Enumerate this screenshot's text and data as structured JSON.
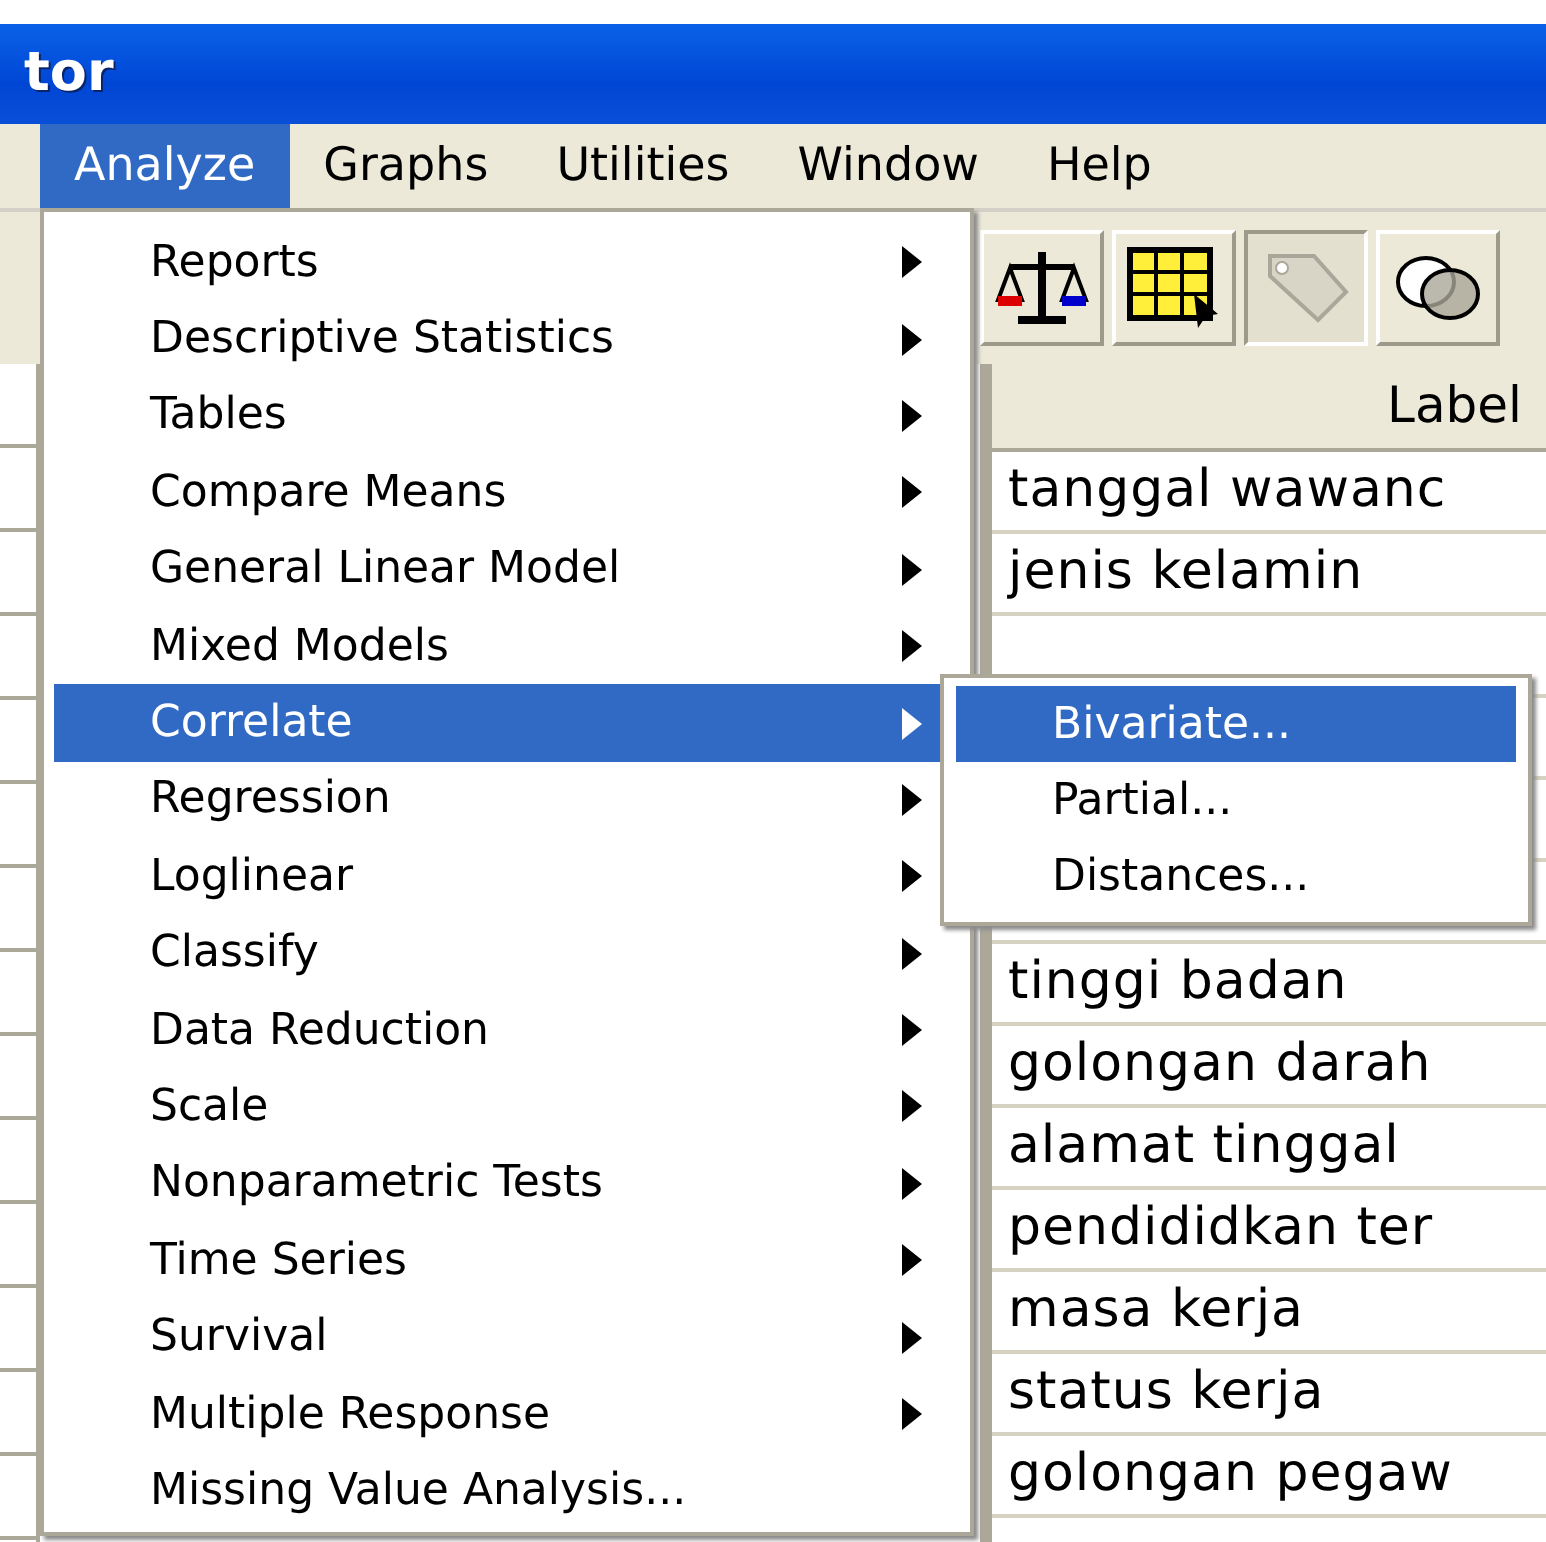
{
  "window": {
    "title": "tor"
  },
  "menu_bar": [
    {
      "label": "Analyze",
      "selected": true
    },
    {
      "label": "Graphs",
      "selected": false
    },
    {
      "label": "Utilities",
      "selected": false
    },
    {
      "label": "Window",
      "selected": false
    },
    {
      "label": "Help",
      "selected": false
    }
  ],
  "analyze_menu": [
    {
      "label": "Reports",
      "kind": "submenu",
      "selected": false
    },
    {
      "label": "Descriptive Statistics",
      "kind": "submenu",
      "selected": false
    },
    {
      "label": "Tables",
      "kind": "submenu",
      "selected": false
    },
    {
      "label": "Compare Means",
      "kind": "submenu",
      "selected": false
    },
    {
      "label": "General Linear Model",
      "kind": "submenu",
      "selected": false
    },
    {
      "label": "Mixed Models",
      "kind": "submenu",
      "selected": false
    },
    {
      "label": "Correlate",
      "kind": "submenu",
      "selected": true
    },
    {
      "label": "Regression",
      "kind": "submenu",
      "selected": false
    },
    {
      "label": "Loglinear",
      "kind": "submenu",
      "selected": false
    },
    {
      "label": "Classify",
      "kind": "submenu",
      "selected": false
    },
    {
      "label": "Data Reduction",
      "kind": "submenu",
      "selected": false
    },
    {
      "label": "Scale",
      "kind": "submenu",
      "selected": false
    },
    {
      "label": "Nonparametric Tests",
      "kind": "submenu",
      "selected": false
    },
    {
      "label": "Time Series",
      "kind": "submenu",
      "selected": false
    },
    {
      "label": "Survival",
      "kind": "submenu",
      "selected": false
    },
    {
      "label": "Multiple Response",
      "kind": "submenu",
      "selected": false
    },
    {
      "label": "Missing Value Analysis...",
      "kind": "command",
      "selected": false
    }
  ],
  "correlate_submenu": [
    {
      "label": "Bivariate...",
      "selected": true
    },
    {
      "label": "Partial...",
      "selected": false
    },
    {
      "label": "Distances...",
      "selected": false
    }
  ],
  "data_grid": {
    "column": "Label",
    "rows_top": [
      "tanggal wawanc",
      "jenis kelamin"
    ],
    "rows_bottom": [
      "tinggi badan",
      "golongan darah",
      "alamat tinggal",
      "pendididkan ter",
      "masa kerja",
      "status kerja",
      "golongan pegaw"
    ]
  }
}
